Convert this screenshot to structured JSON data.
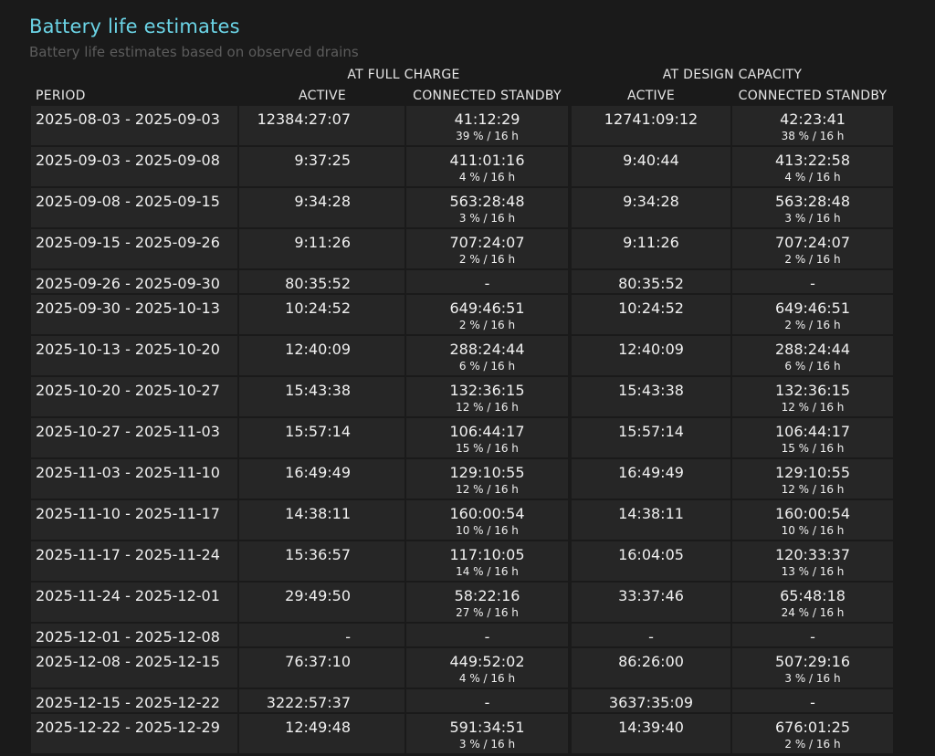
{
  "title": "Battery life estimates",
  "subtitle": "Battery life estimates based on observed drains",
  "group_headers": {
    "full_charge": "AT FULL CHARGE",
    "design_capacity": "AT DESIGN CAPACITY"
  },
  "column_headers": {
    "period": "PERIOD",
    "fc_active": "ACTIVE",
    "fc_standby": "CONNECTED STANDBY",
    "dc_active": "ACTIVE",
    "dc_standby": "CONNECTED STANDBY"
  },
  "rows": [
    {
      "period": "2025-08-03 - 2025-09-03",
      "fc_active": "12384:27:07",
      "fc_standby": "41:12:29",
      "fc_standby_sub": "39 % / 16 h",
      "dc_active": "12741:09:12",
      "dc_standby": "42:23:41",
      "dc_standby_sub": "38 % / 16 h"
    },
    {
      "period": "2025-09-03 - 2025-09-08",
      "fc_active": "9:37:25",
      "fc_standby": "411:01:16",
      "fc_standby_sub": "4 % / 16 h",
      "dc_active": "9:40:44",
      "dc_standby": "413:22:58",
      "dc_standby_sub": "4 % / 16 h"
    },
    {
      "period": "2025-09-08 - 2025-09-15",
      "fc_active": "9:34:28",
      "fc_standby": "563:28:48",
      "fc_standby_sub": "3 % / 16 h",
      "dc_active": "9:34:28",
      "dc_standby": "563:28:48",
      "dc_standby_sub": "3 % / 16 h"
    },
    {
      "period": "2025-09-15 - 2025-09-26",
      "fc_active": "9:11:26",
      "fc_standby": "707:24:07",
      "fc_standby_sub": "2 % / 16 h",
      "dc_active": "9:11:26",
      "dc_standby": "707:24:07",
      "dc_standby_sub": "2 % / 16 h"
    },
    {
      "period": "2025-09-26 - 2025-09-30",
      "fc_active": "80:35:52",
      "fc_standby": "-",
      "fc_standby_sub": "",
      "dc_active": "80:35:52",
      "dc_standby": "-",
      "dc_standby_sub": ""
    },
    {
      "period": "2025-09-30 - 2025-10-13",
      "fc_active": "10:24:52",
      "fc_standby": "649:46:51",
      "fc_standby_sub": "2 % / 16 h",
      "dc_active": "10:24:52",
      "dc_standby": "649:46:51",
      "dc_standby_sub": "2 % / 16 h"
    },
    {
      "period": "2025-10-13 - 2025-10-20",
      "fc_active": "12:40:09",
      "fc_standby": "288:24:44",
      "fc_standby_sub": "6 % / 16 h",
      "dc_active": "12:40:09",
      "dc_standby": "288:24:44",
      "dc_standby_sub": "6 % / 16 h"
    },
    {
      "period": "2025-10-20 - 2025-10-27",
      "fc_active": "15:43:38",
      "fc_standby": "132:36:15",
      "fc_standby_sub": "12 % / 16 h",
      "dc_active": "15:43:38",
      "dc_standby": "132:36:15",
      "dc_standby_sub": "12 % / 16 h"
    },
    {
      "period": "2025-10-27 - 2025-11-03",
      "fc_active": "15:57:14",
      "fc_standby": "106:44:17",
      "fc_standby_sub": "15 % / 16 h",
      "dc_active": "15:57:14",
      "dc_standby": "106:44:17",
      "dc_standby_sub": "15 % / 16 h"
    },
    {
      "period": "2025-11-03 - 2025-11-10",
      "fc_active": "16:49:49",
      "fc_standby": "129:10:55",
      "fc_standby_sub": "12 % / 16 h",
      "dc_active": "16:49:49",
      "dc_standby": "129:10:55",
      "dc_standby_sub": "12 % / 16 h"
    },
    {
      "period": "2025-11-10 - 2025-11-17",
      "fc_active": "14:38:11",
      "fc_standby": "160:00:54",
      "fc_standby_sub": "10 % / 16 h",
      "dc_active": "14:38:11",
      "dc_standby": "160:00:54",
      "dc_standby_sub": "10 % / 16 h"
    },
    {
      "period": "2025-11-17 - 2025-11-24",
      "fc_active": "15:36:57",
      "fc_standby": "117:10:05",
      "fc_standby_sub": "14 % / 16 h",
      "dc_active": "16:04:05",
      "dc_standby": "120:33:37",
      "dc_standby_sub": "13 % / 16 h"
    },
    {
      "period": "2025-11-24 - 2025-12-01",
      "fc_active": "29:49:50",
      "fc_standby": "58:22:16",
      "fc_standby_sub": "27 % / 16 h",
      "dc_active": "33:37:46",
      "dc_standby": "65:48:18",
      "dc_standby_sub": "24 % / 16 h"
    },
    {
      "period": "2025-12-01 - 2025-12-08",
      "fc_active": "-",
      "fc_standby": "-",
      "fc_standby_sub": "",
      "dc_active": "-",
      "dc_standby": "-",
      "dc_standby_sub": ""
    },
    {
      "period": "2025-12-08 - 2025-12-15",
      "fc_active": "76:37:10",
      "fc_standby": "449:52:02",
      "fc_standby_sub": "4 % / 16 h",
      "dc_active": "86:26:00",
      "dc_standby": "507:29:16",
      "dc_standby_sub": "3 % / 16 h"
    },
    {
      "period": "2025-12-15 - 2025-12-22",
      "fc_active": "3222:57:37",
      "fc_standby": "-",
      "fc_standby_sub": "",
      "dc_active": "3637:35:09",
      "dc_standby": "-",
      "dc_standby_sub": ""
    },
    {
      "period": "2025-12-22 - 2025-12-29",
      "fc_active": "12:49:48",
      "fc_standby": "591:34:51",
      "fc_standby_sub": "3 % / 16 h",
      "dc_active": "14:39:40",
      "dc_standby": "676:01:25",
      "dc_standby_sub": "2 % / 16 h"
    }
  ]
}
